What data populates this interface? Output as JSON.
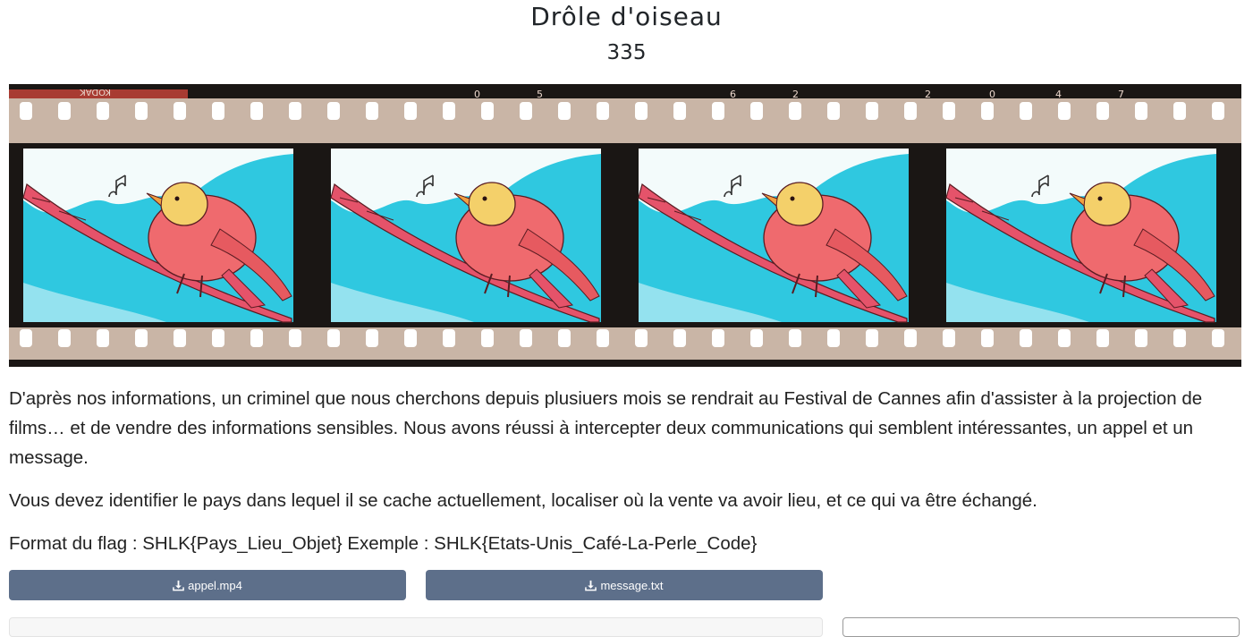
{
  "challenge": {
    "title": "Drôle d'oiseau",
    "points": "335"
  },
  "image": {
    "film_brand": "KODAK",
    "frame_numbers": [
      "0",
      "5",
      "6",
      "2",
      "2",
      "0",
      "4",
      "7"
    ],
    "colors": {
      "film_base": "#c9b5a6",
      "film_edge": "#1a1614",
      "sky": "#2fc8e0",
      "bird": "#ef6a6e",
      "bird_head": "#f4d06a",
      "branch": "#e5536a"
    }
  },
  "description": {
    "paragraph1": "D'après nos informations, un criminel que nous cherchons depuis plusiuers mois se rendrait au Festival de Cannes afin d'assister à la projection de films… et de vendre des informations sensibles. Nous avons réussi à intercepter deux communications qui semblent intéressantes, un appel et un message.",
    "paragraph2": "Vous devez identifier le pays dans lequel il se cache actuellement, localiser où la vente va avoir lieu, et ce qui va être échangé.",
    "paragraph3": "Format du flag : SHLK{Pays_Lieu_Objet} Exemple : SHLK{Etats-Unis_Café-La-Perle_Code}"
  },
  "files": [
    {
      "label": "appel.mp4",
      "icon": "download-icon"
    },
    {
      "label": "message.txt",
      "icon": "download-icon"
    }
  ],
  "theme": {
    "button_bg": "#5d6f8a",
    "button_text": "#ffffff"
  }
}
